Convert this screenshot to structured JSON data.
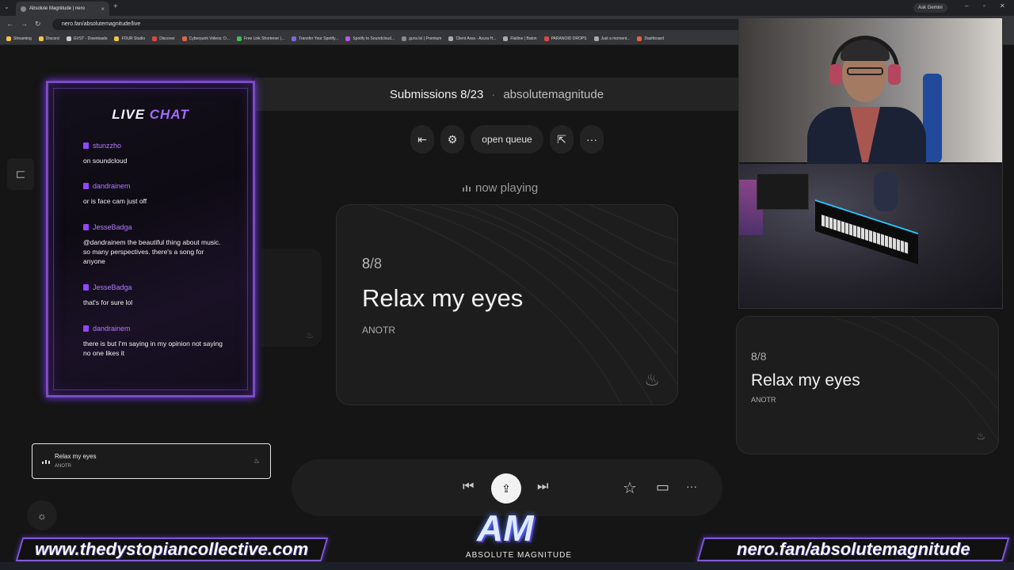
{
  "browser": {
    "tab_title": "Absolute Magnitude | nero",
    "tab_close": "×",
    "new_tab": "+",
    "url": "nero.fan/absolutemagnitude/live",
    "ask_gemini": "Ask Gemini",
    "bookmarks": [
      {
        "label": "Streaming",
        "color": "#f4c542"
      },
      {
        "label": "Discord",
        "color": "#f4c542"
      },
      {
        "label": "GVST - Downloads",
        "color": "#cccccc"
      },
      {
        "label": "FOUR Studio",
        "color": "#f4c542"
      },
      {
        "label": "Discover",
        "color": "#e04545"
      },
      {
        "label": "Cyberpunk Videos: D...",
        "color": "#e06545"
      },
      {
        "label": "Free Link Shortener |...",
        "color": "#3cbf5a"
      },
      {
        "label": "Transfer Your Spotify...",
        "color": "#7a6ae0"
      },
      {
        "label": "Spotify to Soundcloud...",
        "color": "#b45ae0"
      },
      {
        "label": "guns.lol | Premium",
        "color": "#888888"
      },
      {
        "label": "Client Area - Azura H...",
        "color": "#aaaaaa"
      },
      {
        "label": "Flatline | Baton",
        "color": "#aaaaaa"
      },
      {
        "label": "PARANOID DROPS",
        "color": "#e04545"
      },
      {
        "label": "Just a moment...",
        "color": "#aaaaaa"
      },
      {
        "label": "Dashboard",
        "color": "#e06545"
      }
    ]
  },
  "header": {
    "submissions": "Submissions 8/23",
    "separator": "·",
    "username": "absolutemagnitude"
  },
  "toolbar": {
    "exit_icon": "⇤",
    "settings_icon": "⚙",
    "open_queue": "open queue",
    "share_icon": "⇱",
    "more_icon": "···"
  },
  "now_playing": {
    "label": "now playing"
  },
  "current_track": {
    "count_current": "8",
    "count_sep": "/",
    "count_total": "8",
    "title": "Relax my eyes",
    "artist": "ANOTR"
  },
  "side_track": {
    "count_current": "8",
    "count_sep": "/",
    "count_total": "8",
    "title": "Relax my eyes",
    "artist": "ANOTR"
  },
  "mini_player": {
    "title": "Relax my eyes",
    "artist": "ANOTR"
  },
  "player": {
    "prev_icon": "⏮",
    "upload_icon": "⇪",
    "next_icon": "⏭",
    "star_icon": "☆",
    "video_icon": "▭",
    "more_icon": "···"
  },
  "settings_icon": "☼",
  "sidebar_icon": "⊏",
  "flame_icon": "♨",
  "live_chat": {
    "title_word1": "LIVE",
    "title_word2": "CHAT",
    "messages": [
      {
        "user": "stunzzho",
        "text": "on soundcloud"
      },
      {
        "user": "dandrainem",
        "text": "or is face cam just off"
      },
      {
        "user": "JesseBadga",
        "text": "@dandrainem the beautiful thing about music. so many perspectives. there's a song for anyone"
      },
      {
        "user": "JesseBadga",
        "text": "that's for sure lol"
      },
      {
        "user": "dandrainem",
        "text": "there is but I'm saying in my opinion not saying no one likes it"
      }
    ]
  },
  "logo": {
    "mark": "AM",
    "text": "ABSOLUTE MAGNITUDE"
  },
  "banners": {
    "left": "www.thedystopiancollective.com",
    "right": "nero.fan/absolutemagnitude"
  }
}
